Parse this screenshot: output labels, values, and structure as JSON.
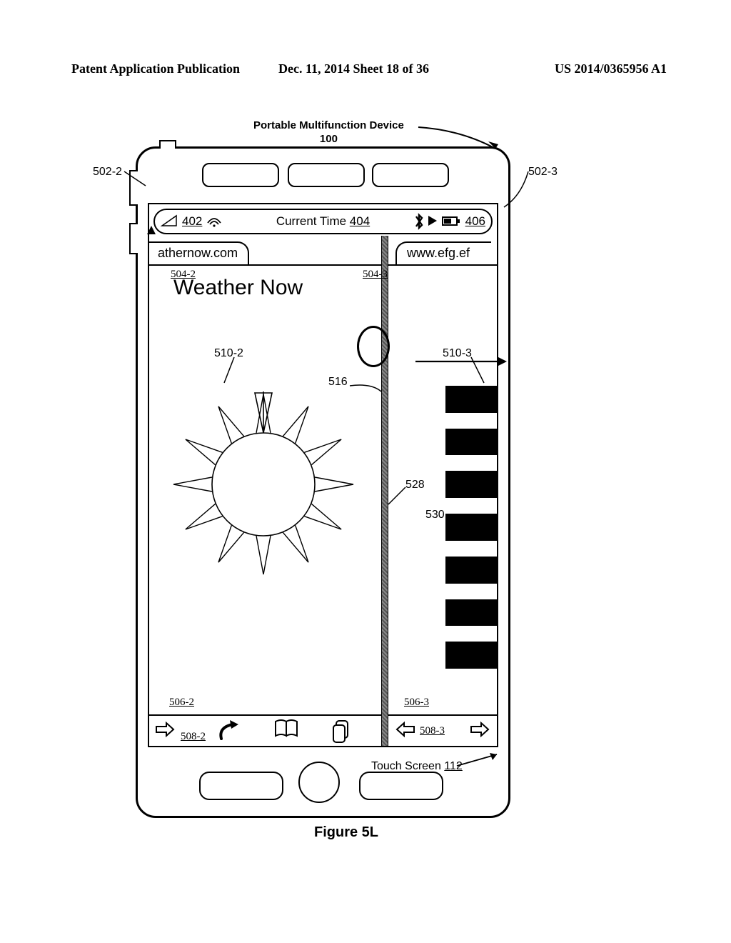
{
  "header": {
    "left": "Patent Application Publication",
    "center": "Dec. 11, 2014  Sheet 18 of 36",
    "right": "US 2014/0365956 A1"
  },
  "figure": {
    "title": "Portable Multifunction Device",
    "title_ref": "100",
    "caption": "Figure 5L"
  },
  "status_bar": {
    "signal_ref": "402",
    "time_label": "Current Time",
    "time_ref": "404",
    "battery_ref": "406"
  },
  "left_pane": {
    "url": "athernow.com",
    "url_ref": "504-2",
    "heading": "Weather Now",
    "content_ref_510": "510-2",
    "bottom_ref_506": "506-2",
    "toolbar_ref_508": "508-2"
  },
  "right_pane": {
    "url": "www.efg.ef",
    "url_ref": "504-3",
    "content_ref_510": "510-3",
    "bottom_ref_506": "506-3",
    "toolbar_ref_508": "508-3"
  },
  "callouts": {
    "top_left": "502-2",
    "top_right": "502-3",
    "divider": "516",
    "touch": "528",
    "arrow": "530",
    "touch_screen": "Touch Screen",
    "touch_screen_ref": "112"
  }
}
